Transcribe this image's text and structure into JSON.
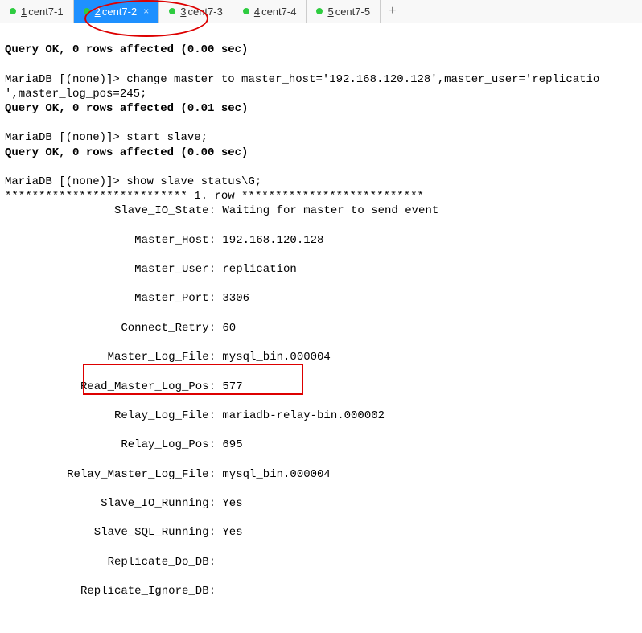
{
  "tabs": [
    {
      "num": "1",
      "label": "cent7-1",
      "active": false
    },
    {
      "num": "2",
      "label": "cent7-2",
      "active": true
    },
    {
      "num": "3",
      "label": "cent7-3",
      "active": false
    },
    {
      "num": "4",
      "label": "cent7-4",
      "active": false
    },
    {
      "num": "5",
      "label": "cent7-5",
      "active": false
    }
  ],
  "add_tab": "+",
  "close_glyph": "×",
  "terminal": {
    "line1": "Query OK, 0 rows affected (0.00 sec)",
    "blank": "",
    "prompt": "MariaDB [(none)]> ",
    "cmd_change": "change master to master_host='192.168.120.128',master_user='replicatio",
    "cmd_change2": "',master_log_pos=245;",
    "line2": "Query OK, 0 rows affected (0.01 sec)",
    "cmd_start": "start slave;",
    "line3": "Query OK, 0 rows affected (0.00 sec)",
    "cmd_show": "show slave status\\G;",
    "stars": "*************************** 1. row ***************************",
    "kv": [
      {
        "k": "Slave_IO_State:",
        "v": " Waiting for master to send event"
      },
      {
        "k": "Master_Host:",
        "v": " 192.168.120.128"
      },
      {
        "k": "Master_User:",
        "v": " replication"
      },
      {
        "k": "Master_Port:",
        "v": " 3306"
      },
      {
        "k": "Connect_Retry:",
        "v": " 60"
      },
      {
        "k": "Master_Log_File:",
        "v": " mysql_bin.000004"
      },
      {
        "k": "Read_Master_Log_Pos:",
        "v": " 577"
      },
      {
        "k": "Relay_Log_File:",
        "v": " mariadb-relay-bin.000002"
      },
      {
        "k": "Relay_Log_Pos:",
        "v": " 695"
      },
      {
        "k": "Relay_Master_Log_File:",
        "v": " mysql_bin.000004"
      },
      {
        "k": "Slave_IO_Running:",
        "v": " Yes"
      },
      {
        "k": "Slave_SQL_Running:",
        "v": " Yes"
      },
      {
        "k": "Replicate_Do_DB:",
        "v": ""
      },
      {
        "k": "Replicate_Ignore_DB:",
        "v": ""
      }
    ]
  }
}
